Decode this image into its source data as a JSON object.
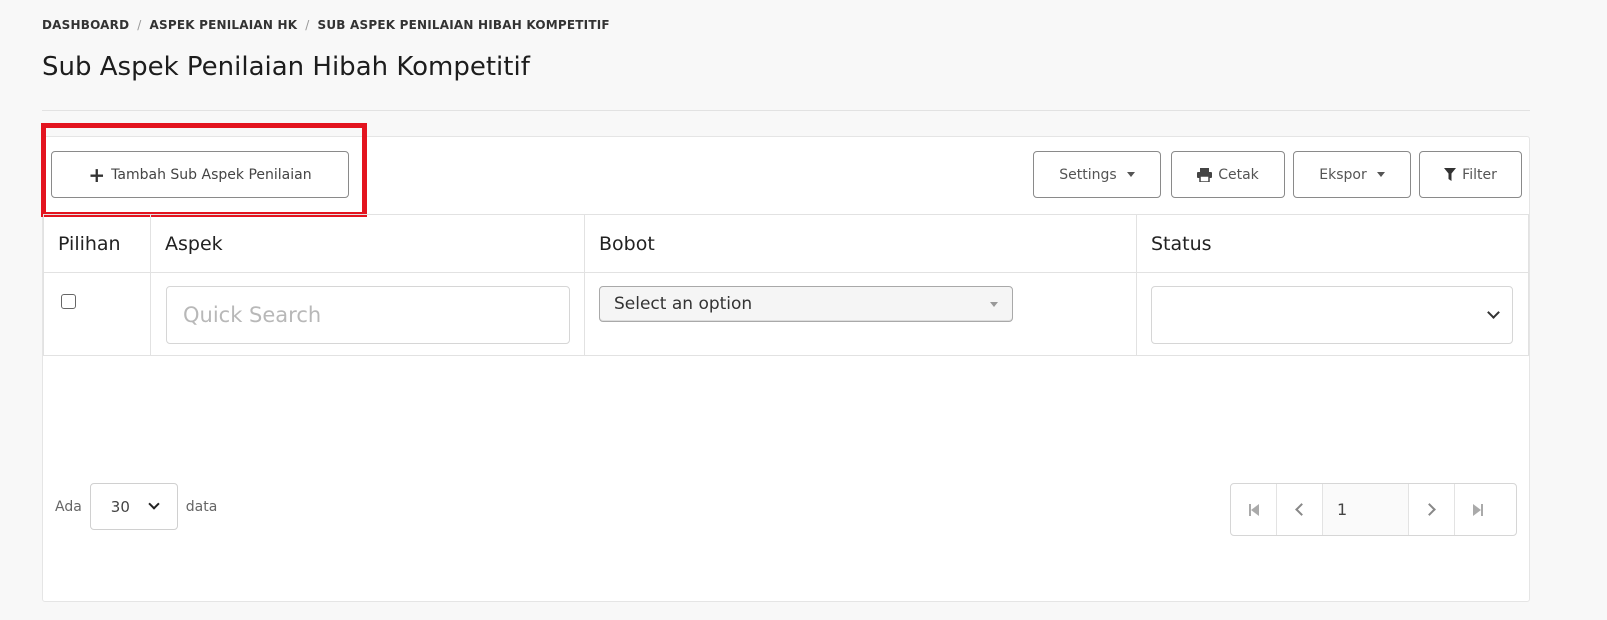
{
  "breadcrumb": {
    "items": [
      "DASHBOARD",
      "ASPEK PENILAIAN HK",
      "SUB ASPEK PENILAIAN HIBAH KOMPETITIF"
    ],
    "separator": "/"
  },
  "page": {
    "title": "Sub Aspek Penilaian Hibah Kompetitif"
  },
  "toolbar": {
    "add_label": "Tambah Sub Aspek Penilaian",
    "add_icon": "plus-icon",
    "settings_label": "Settings",
    "cetak_label": "Cetak",
    "cetak_icon": "printer-icon",
    "ekspor_label": "Ekspor",
    "filter_label": "Filter",
    "filter_icon": "funnel-icon",
    "highlight_color": "#e3141f"
  },
  "table": {
    "columns": [
      "Pilihan",
      "Aspek",
      "Bobot",
      "Status"
    ],
    "filters": {
      "aspek_placeholder": "Quick Search",
      "bobot_placeholder": "Select an option",
      "status_value": ""
    }
  },
  "footer": {
    "prefix": "Ada",
    "page_size": "30",
    "suffix": "data",
    "current_page": "1"
  }
}
